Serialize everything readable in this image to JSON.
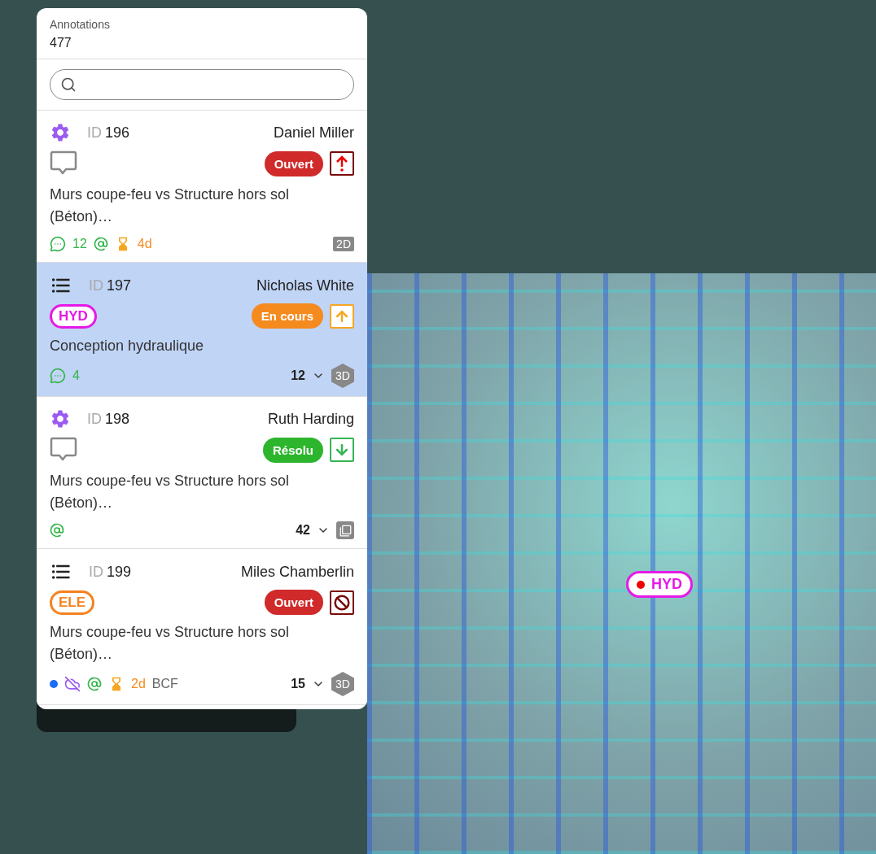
{
  "panel": {
    "title": "Annotations",
    "count": "477"
  },
  "annotations": [
    {
      "kind": "gear",
      "id_label": "ID",
      "id": "196",
      "author": "Daniel Miller",
      "selected": false,
      "status": {
        "label": "Ouvert",
        "color": "#d02a2a"
      },
      "priority": {
        "kind": "urgent",
        "color": "#7a0a0a"
      },
      "title": "Murs coupe-feu vs Structure hors sol (Béton)…",
      "comments": "12",
      "mention": true,
      "due": "4d",
      "view": {
        "kind": "flat",
        "label": "2D"
      }
    },
    {
      "kind": "list",
      "id_label": "ID",
      "id": "197",
      "author": "Nicholas White",
      "selected": true,
      "tag": {
        "label": "HYD",
        "color": "#e619e6"
      },
      "status": {
        "label": "En cours",
        "color": "#f58a1f"
      },
      "priority": {
        "kind": "up",
        "color": "#f5a623"
      },
      "title": "Conception hydraulique",
      "comments": "4",
      "count": "12",
      "view": {
        "kind": "hex",
        "label": "3D"
      }
    },
    {
      "kind": "gear",
      "id_label": "ID",
      "id": "198",
      "author": "Ruth Harding",
      "selected": false,
      "status": {
        "label": "Résolu",
        "color": "#2db52d"
      },
      "priority": {
        "kind": "down",
        "color": "#35b556"
      },
      "title": "Murs coupe-feu vs Structure hors sol (Béton)…",
      "mention": true,
      "count": "42",
      "view": {
        "kind": "copy"
      }
    },
    {
      "kind": "list",
      "id_label": "ID",
      "id": "199",
      "author": "Miles Chamberlin",
      "selected": false,
      "tag": {
        "label": "ELE",
        "color": "#f5821f"
      },
      "status": {
        "label": "Ouvert",
        "color": "#d02a2a"
      },
      "priority": {
        "kind": "blocked",
        "color": "#7a0a0a"
      },
      "title": "Murs coupe-feu vs Structure hors sol (Béton)…",
      "dot": {
        "color": "#1a6ef5"
      },
      "hidden": true,
      "mention": true,
      "due": "2d",
      "format": "BCF",
      "count": "15",
      "view": {
        "kind": "hex",
        "label": "3D"
      }
    }
  ],
  "viewer": {
    "marker": {
      "label": "HYD",
      "selected": true
    }
  }
}
